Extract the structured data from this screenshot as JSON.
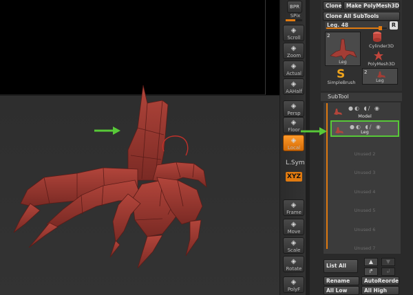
{
  "toolbar": {
    "bpr_label": "BPR",
    "spix_label": "SPix",
    "spix_level": 0.6,
    "items": [
      {
        "label": "Scroll",
        "icon": "scroll-icon"
      },
      {
        "label": "Zoom",
        "icon": "zoom-icon"
      },
      {
        "label": "Actual",
        "icon": "actual-icon"
      },
      {
        "label": "AAHalf",
        "icon": "aahalf-icon"
      },
      {
        "label": "Persp",
        "icon": "persp-icon"
      },
      {
        "label": "Floor",
        "icon": "floor-icon"
      },
      {
        "label": "Local",
        "icon": "local-icon",
        "active": true
      },
      {
        "label": "L.Sym",
        "icon": "lsym-icon"
      },
      {
        "label": "XYZ",
        "icon": "xyz-icon",
        "active": true
      },
      {
        "label": "Frame",
        "icon": "frame-icon"
      },
      {
        "label": "Move",
        "icon": "move-icon"
      },
      {
        "label": "Scale",
        "icon": "scale-icon"
      },
      {
        "label": "Rotate",
        "icon": "rotate-icon"
      },
      {
        "label": "PolyF",
        "icon": "polyf-icon"
      }
    ]
  },
  "tool_palette": {
    "clone_label": "Clone",
    "make_polymesh_label": "Make PolyMesh3D",
    "clone_all_label": "Clone All SubTools",
    "slider_label": "Leg. 48",
    "slider_value": 0.9,
    "r_label": "R",
    "tools": [
      {
        "name": "Leg",
        "count": "2"
      },
      {
        "name": "Cylinder3D"
      },
      {
        "name": "PolyMesh3D"
      },
      {
        "name": "SimpleBrush"
      },
      {
        "name": "Leg",
        "count": "2"
      }
    ]
  },
  "subtool": {
    "header": "SubTool",
    "slots": [
      {
        "name": "Model",
        "selected": false,
        "visible": true
      },
      {
        "name": "Leg",
        "selected": true,
        "visible": true
      },
      {
        "name": "Unused 2"
      },
      {
        "name": "Unused 3"
      },
      {
        "name": "Unused 4"
      },
      {
        "name": "Unused 5"
      },
      {
        "name": "Unused 6"
      },
      {
        "name": "Unused 7"
      }
    ],
    "list_all_label": "List All",
    "rename_label": "Rename",
    "autoreorder_label": "AutoReorder",
    "all_low_label": "All Low",
    "all_high_label": "All High"
  },
  "colors": {
    "accent": "#e07a10",
    "highlight": "#58c938",
    "model": "#9b3a32"
  }
}
